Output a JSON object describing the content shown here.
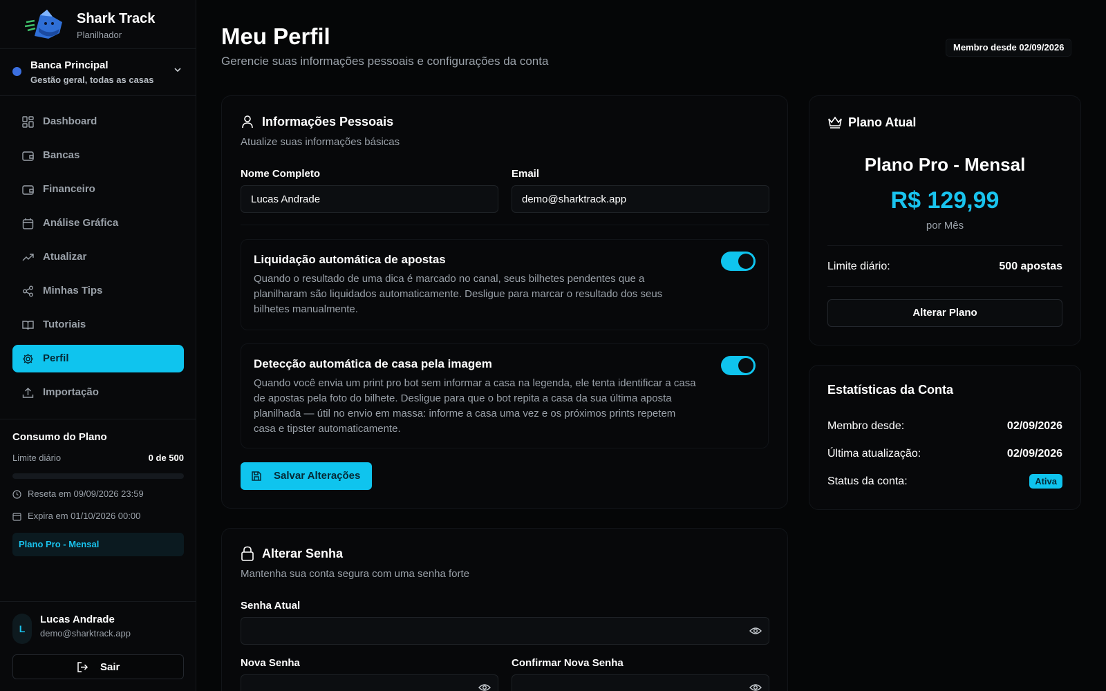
{
  "brand": {
    "title": "Shark Track",
    "subtitle": "Planilhador"
  },
  "bank": {
    "name": "Banca Principal",
    "subtitle": "Gestão geral, todas as casas"
  },
  "nav": [
    {
      "label": "Dashboard",
      "icon": "grid-icon"
    },
    {
      "label": "Bancas",
      "icon": "wallet-icon"
    },
    {
      "label": "Financeiro",
      "icon": "wallet-icon"
    },
    {
      "label": "Análise Gráfica",
      "icon": "calendar-icon"
    },
    {
      "label": "Atualizar",
      "icon": "trend-up-icon"
    },
    {
      "label": "Minhas Tips",
      "icon": "share-icon"
    },
    {
      "label": "Tutoriais",
      "icon": "book-icon"
    },
    {
      "label": "Perfil",
      "icon": "gear-icon",
      "active": true
    },
    {
      "label": "Importação",
      "icon": "upload-icon"
    }
  ],
  "usage": {
    "title": "Consumo do Plano",
    "limit_label": "Limite diário",
    "limit_value": "0 de 500",
    "progress": 0,
    "reset": "Reseta em 09/09/2026 23:59",
    "expires": "Expira em 01/10/2026 00:00",
    "plan": "Plano Pro - Mensal"
  },
  "user": {
    "initial": "L",
    "name": "Lucas Andrade",
    "email": "demo@sharktrack.app",
    "logout": "Sair"
  },
  "header": {
    "title": "Meu Perfil",
    "subtitle": "Gerencie suas informações pessoais e configurações da conta",
    "member_badge": "Membro desde 02/09/2026"
  },
  "personal": {
    "title": "Informações Pessoais",
    "subtitle": "Atualize suas informações básicas",
    "name_label": "Nome Completo",
    "name_value": "Lucas Andrade",
    "email_label": "Email",
    "email_value": "demo@sharktrack.app",
    "options": [
      {
        "title": "Liquidação automática de apostas",
        "desc": "Quando o resultado de uma dica é marcado no canal, seus bilhetes pendentes que a planilharam são liquidados automaticamente. Desligue para marcar o resultado dos seus bilhetes manualmente.",
        "enabled": true
      },
      {
        "title": "Detecção automática de casa pela imagem",
        "desc": "Quando você envia um print pro bot sem informar a casa na legenda, ele tenta identificar a casa de apostas pela foto do bilhete. Desligue para que o bot repita a casa da sua última aposta planilhada — útil no envio em massa: informe a casa uma vez e os próximos prints repetem casa e tipster automaticamente.",
        "enabled": true
      }
    ],
    "save_label": "Salvar Alterações"
  },
  "password": {
    "title": "Alterar Senha",
    "subtitle": "Mantenha sua conta segura com uma senha forte",
    "current_label": "Senha Atual",
    "new_label": "Nova Senha",
    "confirm_label": "Confirmar Nova Senha"
  },
  "plan_card": {
    "title": "Plano Atual",
    "name": "Plano Pro - Mensal",
    "price": "R$ 129,99",
    "period": "por Mês",
    "limit_label": "Limite diário:",
    "limit_value": "500 apostas",
    "change_label": "Alterar Plano"
  },
  "stats": {
    "title": "Estatísticas da Conta",
    "member_label": "Membro desde:",
    "member_value": "02/09/2026",
    "updated_label": "Última atualização:",
    "updated_value": "02/09/2026",
    "status_label": "Status da conta:",
    "status_value": "Ativa"
  },
  "colors": {
    "accent": "#0fc4ee",
    "background": "#050607",
    "muted": "#9aa1a9"
  }
}
